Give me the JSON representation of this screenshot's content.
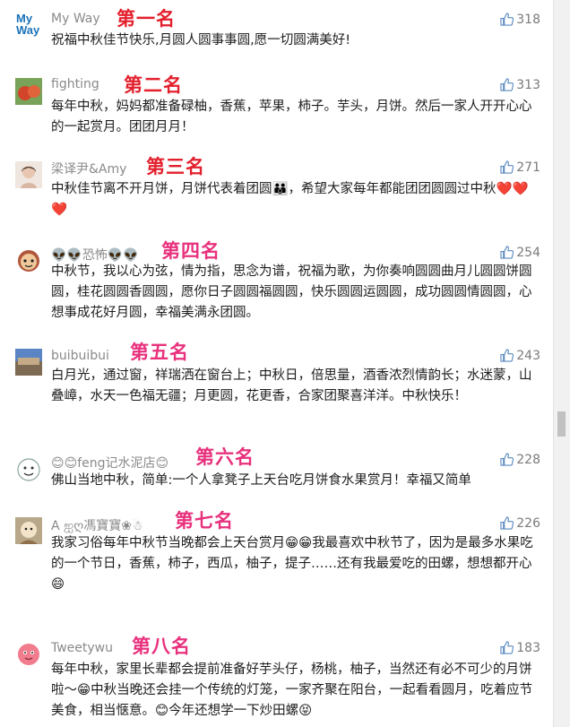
{
  "comments": [
    {
      "user": "My Way",
      "rank": "第一名",
      "likes": "318",
      "text": "祝福中秋佳节快乐,月圆人圆事事圆,愿一切圆满美好!"
    },
    {
      "user": "fighting",
      "rank": "第二名",
      "likes": "313",
      "text": "每年中秋，妈妈都准备碌柚，香蕉，苹果，柿子。芋头，月饼。然后一家人开开心心的一起赏月。团团月月！"
    },
    {
      "user": "梁译尹&Amy",
      "rank": "第三名",
      "likes": "271",
      "text": "中秋佳节离不开月饼，月饼代表着团圆👪，希望大家每年都能团团圆圆过中秋❤️❤️❤️"
    },
    {
      "user": "👽👽恐怖👽👽",
      "rank": "第四名",
      "likes": "254",
      "text": "中秋节，我以心为弦，情为指，思念为谱，祝福为歌，为你奏响圆圆曲月儿圆圆饼圆圆，桂花圆圆香圆圆，愿你日子圆圆福圆圆，快乐圆圆运圆圆，成功圆圆情圆圆，心想事成花好月圆，幸福美满永团圆。"
    },
    {
      "user": "buibuibui",
      "rank": "第五名",
      "likes": "243",
      "text": "白月光，通过窗，祥瑞洒在窗台上；中秋日，倍思量，酒香浓烈情韵长；水迷蒙，山叠嶂，水天一色福无疆；月更圆，花更香，合家团聚喜洋洋。中秋快乐！"
    },
    {
      "user": "😊😊feng记水泥店😊",
      "rank": "第六名",
      "likes": "228",
      "text": "佛山当地中秋，简单:一个人拿凳子上天台吃月饼食水果赏月！幸福又简单"
    },
    {
      "user": "A ஐღ馮寶寶❀☃",
      "rank": "第七名",
      "likes": "226",
      "text": "我家习俗每年中秋节当晚都会上天台赏月😁😁我最喜欢中秋节了，因为是最多水果吃的一个节日，香蕉，柿子，西瓜，柚子，提子……还有我最爱吃的田螺，想想都开心😄"
    },
    {
      "user": "Tweetywu",
      "rank": "第八名",
      "likes": "183",
      "text": "每年中秋，家里长辈都会提前准备好芋头仔，杨桃，柚子，当然还有必不可少的月饼啦～😁中秋当晚还会挂一个传统的灯笼，一家齐聚在阳台，一起看看圆月，吃着应节美食，相当惬意。😊今年还想学一下炒田螺😝"
    }
  ],
  "colors": {
    "rank_red": "#e3202d",
    "rank_magenta": "#e8317d",
    "username": "#8a8a8a",
    "text": "#1c1c1c",
    "likes": "#7a7a7a",
    "avatar1_blue": "#1a72b8"
  },
  "icons": {
    "like": "thumbs-up-icon"
  }
}
